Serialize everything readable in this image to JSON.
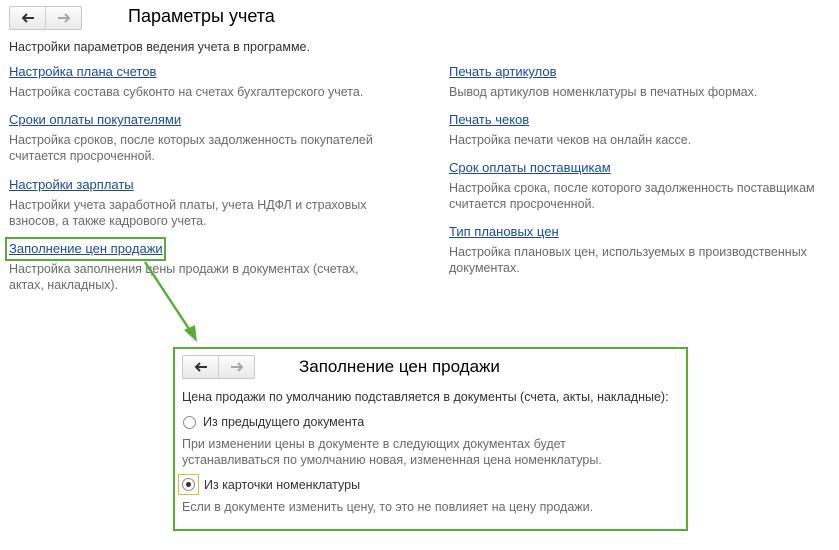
{
  "header": {
    "title": "Параметры учета",
    "subtitle": "Настройки параметров ведения учета в программе."
  },
  "left_column": [
    {
      "label": "Настройка плана счетов",
      "description": "Настройка состава субконто на счетах бухгалтерского учета."
    },
    {
      "label": "Сроки оплаты покупателями",
      "description_lines": [
        "Настройка сроков, после которых задолженность покупателей",
        "считается просроченной."
      ]
    },
    {
      "label": "Настройки зарплаты",
      "description_lines": [
        "Настройки учета заработной платы, учета НДФЛ и страховых",
        "взносов, а также кадрового учета."
      ]
    },
    {
      "label": "Заполнение цен продажи",
      "description_lines": [
        "Настройка заполнения цены продажи в документах (счетах,",
        "актах, накладных)."
      ]
    }
  ],
  "right_column": [
    {
      "label": "Печать артикулов",
      "description": "Вывод артикулов номенклатуры в печатных формах."
    },
    {
      "label": "Печать чеков",
      "description": "Настройка печати чеков на онлайн кассе."
    },
    {
      "label": "Срок оплаты поставщикам",
      "description_lines": [
        "Настройка срока, после которого задолженность поставщикам",
        "считается просроченной."
      ]
    },
    {
      "label": "Тип плановых цен",
      "description_lines": [
        "Настройка плановых цен, используемых в производственных",
        "документах."
      ]
    }
  ],
  "sub_panel": {
    "title": "Заполнение цен продажи",
    "prompt": "Цена продажи по умолчанию подставляется в документы (счета, акты, накладные):",
    "options": [
      {
        "label": "Из предыдущего документа",
        "selected": false,
        "description_lines": [
          "При изменении цены в документе в следующих документах будет",
          "устанавливаться по умолчанию новая, измененная цена номенклатуры."
        ]
      },
      {
        "label": "Из карточки номенклатуры",
        "selected": true,
        "description_lines": [
          "Если в документе изменить цену, то это не повлияет на цену продажи."
        ]
      }
    ]
  },
  "colors": {
    "link": "#1b4b9a",
    "highlight": "#5aac3a",
    "description": "#6b6b6b",
    "radio_focus": "#e3b93a"
  },
  "icons": [
    "back-arrow-icon",
    "forward-arrow-icon"
  ]
}
